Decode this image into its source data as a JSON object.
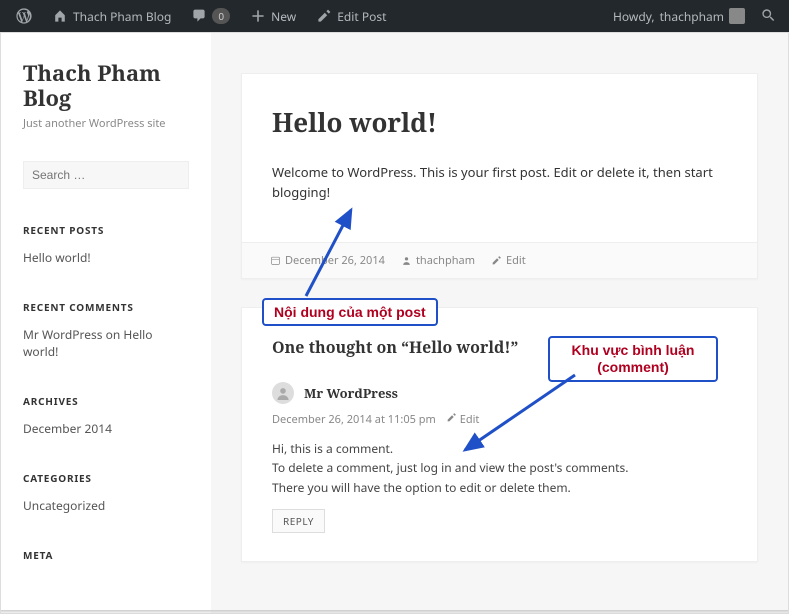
{
  "adminbar": {
    "site_name": "Thach Pham Blog",
    "comments_count": "0",
    "new_label": "New",
    "edit_label": "Edit Post",
    "howdy_prefix": "Howdy, ",
    "user": "thachpham"
  },
  "sidebar": {
    "site_title": "Thach Pham Blog",
    "tagline": "Just another WordPress site",
    "search_placeholder": "Search …",
    "widgets": {
      "recent_posts": {
        "title": "RECENT POSTS",
        "items": [
          "Hello world!"
        ]
      },
      "recent_comments": {
        "title": "RECENT COMMENTS",
        "items_raw": [
          {
            "author": "Mr WordPress",
            "on_word": "on",
            "post": "Hello world!"
          }
        ]
      },
      "archives": {
        "title": "ARCHIVES",
        "items": [
          "December 2014"
        ]
      },
      "categories": {
        "title": "CATEGORIES",
        "items": [
          "Uncategorized"
        ]
      },
      "meta": {
        "title": "META"
      }
    }
  },
  "post": {
    "title": "Hello world!",
    "content": "Welcome to WordPress. This is your first post. Edit or delete it, then start blogging!",
    "meta": {
      "date": "December 26, 2014",
      "author": "thachpham",
      "edit": "Edit"
    }
  },
  "comments": {
    "title_prefix": "One thought on “",
    "title_post": "Hello world!",
    "title_suffix": "”",
    "list": [
      {
        "author": "Mr WordPress",
        "date": "December 26, 2014 at 11:05 pm",
        "edit": "Edit",
        "body_line1": "Hi, this is a comment.",
        "body_line2": "To delete a comment, just log in and view the post's comments.",
        "body_line3": "There you will have the option to edit or delete them.",
        "reply": "REPLY"
      }
    ]
  },
  "annotations": {
    "post_label": "Nội dung của một post",
    "comment_label": "Khu vực bình luận (comment)"
  }
}
